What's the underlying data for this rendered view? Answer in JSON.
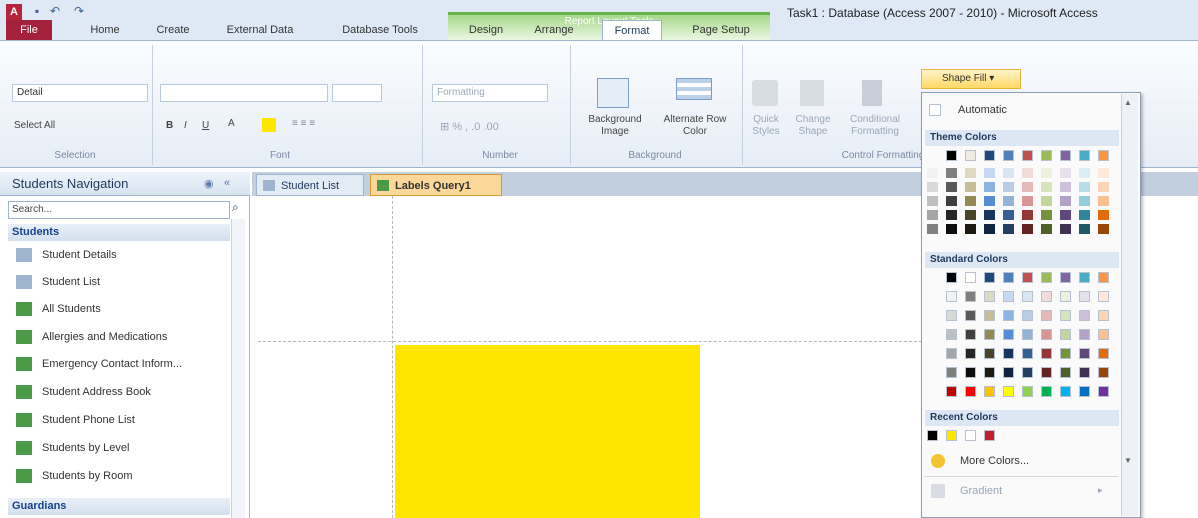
{
  "window": {
    "title": "Task1 : Database (Access 2007 - 2010)  -  Microsoft Access",
    "context_tools": "Report Layout Tools"
  },
  "tabs": [
    "Home",
    "Create",
    "External Data",
    "Database Tools",
    "Design",
    "Arrange",
    "Format",
    "Page Setup"
  ],
  "file_tab": "File",
  "active_tab": "Format",
  "ribbon": {
    "selection": {
      "dropdown": "Detail",
      "select_all": "Select All",
      "label": "Selection"
    },
    "font": {
      "label": "Font",
      "bold": "B",
      "italic": "I",
      "underline": "U"
    },
    "number": {
      "dropdown": "Formatting",
      "label": "Number"
    },
    "background": {
      "background_image": "Background Image",
      "alternate_row": "Alternate Row Color",
      "label": "Background"
    },
    "control": {
      "quick_styles": "Quick Styles",
      "change_shape": "Change Shape",
      "conditional": "Conditional Formatting",
      "label": "Control Formatting"
    },
    "shape_fill": "Shape Fill"
  },
  "nav": {
    "title": "Students Navigation",
    "search_placeholder": "Search...",
    "groups": [
      {
        "name": "Students",
        "items": [
          "Student Details",
          "Student List",
          "All Students",
          "Allergies and Medications",
          "Emergency Contact Inform...",
          "Student Address Book",
          "Student Phone List",
          "Students by Level",
          "Students by Room"
        ]
      },
      {
        "name": "Guardians",
        "items": []
      }
    ]
  },
  "doc_tabs": [
    "Student List",
    "Labels Query1"
  ],
  "palette": {
    "automatic": "Automatic",
    "theme_header": "Theme Colors",
    "standard_header": "Standard Colors",
    "recent_header": "Recent Colors",
    "more_colors": "More Colors...",
    "gradient": "Gradient",
    "theme_top": [
      "#000000",
      "#eeece1",
      "#1f497d",
      "#4f81bd",
      "#c0504d",
      "#9bbb59",
      "#8064a2",
      "#4bacc6",
      "#f79646"
    ],
    "theme_cols": [
      [
        "#f2f2f2",
        "#d9d9d9",
        "#bfbfbf",
        "#a6a6a6",
        "#808080"
      ],
      [
        "#7f7f7f",
        "#595959",
        "#3f3f3f",
        "#262626",
        "#0d0d0d"
      ],
      [
        "#ddd9c3",
        "#c4bd97",
        "#938953",
        "#494429",
        "#1d1b10"
      ],
      [
        "#c6d9f0",
        "#8db3e2",
        "#548dd4",
        "#17365d",
        "#0f243e"
      ],
      [
        "#dbe5f1",
        "#b8cce4",
        "#95b3d7",
        "#366092",
        "#244061"
      ],
      [
        "#f2dcdb",
        "#e5b9b7",
        "#d99694",
        "#953734",
        "#632423"
      ],
      [
        "#ebf1dd",
        "#d7e3bc",
        "#c3d69b",
        "#76923c",
        "#4f6128"
      ],
      [
        "#e5e0ec",
        "#ccc1d9",
        "#b2a2c7",
        "#5f497a",
        "#3f3151"
      ],
      [
        "#dbeef3",
        "#b7dde8",
        "#92cddc",
        "#31859b",
        "#205867"
      ],
      [
        "#fdeada",
        "#fbd5b5",
        "#fac08f",
        "#e36c09",
        "#974806"
      ]
    ],
    "standard_rows": [
      [
        "#000000",
        "#ffffff",
        "#1f497d",
        "#4f81bd",
        "#c0504d",
        "#9bbb59",
        "#8064a2",
        "#4bacc6",
        "#f79646"
      ],
      [
        "#f2f2f2",
        "#7f7f7f",
        "#ddd9c3",
        "#c6d9f0",
        "#dbe5f1",
        "#f2dcdb",
        "#ebf1dd",
        "#e5e0ec",
        "#fdeada"
      ],
      [
        "#d9d9d9",
        "#595959",
        "#c4bd97",
        "#8db3e2",
        "#b8cce4",
        "#e5b9b7",
        "#d7e3bc",
        "#ccc1d9",
        "#fbd5b5"
      ],
      [
        "#bfbfbf",
        "#3f3f3f",
        "#938953",
        "#548dd4",
        "#95b3d7",
        "#d99694",
        "#c3d69b",
        "#b2a2c7",
        "#fac08f"
      ],
      [
        "#a6a6a6",
        "#262626",
        "#494429",
        "#17365d",
        "#366092",
        "#953734",
        "#76923c",
        "#5f497a",
        "#e36c09"
      ],
      [
        "#7f7f7f",
        "#0d0d0d",
        "#1d1b10",
        "#0f243e",
        "#244061",
        "#632423",
        "#4f6128",
        "#3f3151",
        "#974806"
      ],
      [
        "#c00000",
        "#ff0000",
        "#ffc000",
        "#ffff00",
        "#92d050",
        "#00b050",
        "#00b0f0",
        "#0070c0",
        "#7030a0"
      ]
    ],
    "recent": [
      "#000000",
      "#ffe600",
      "#ffffff",
      "#c0202a"
    ]
  },
  "report_box_color": "#ffe600"
}
